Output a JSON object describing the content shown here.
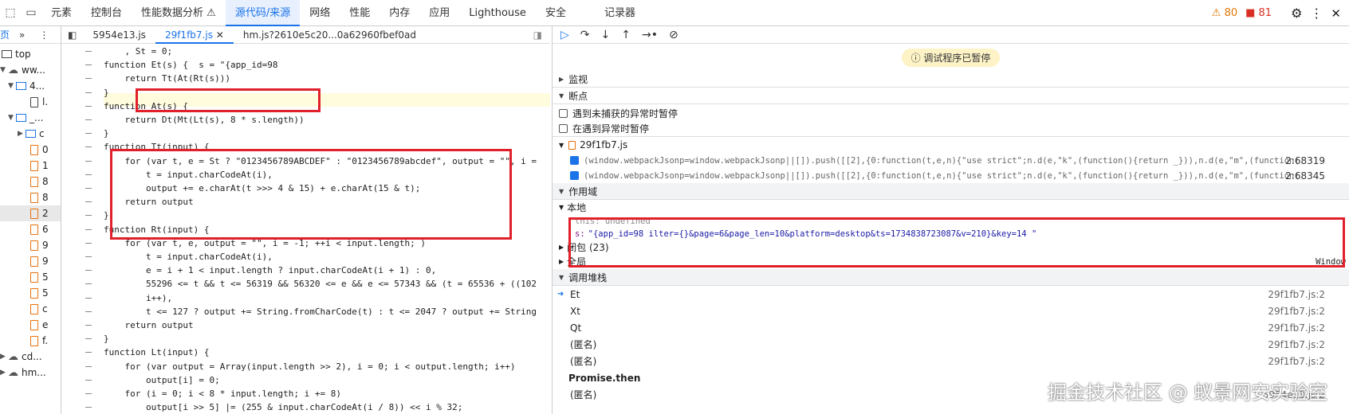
{
  "tabs": [
    "元素",
    "控制台",
    "性能数据分析 ⚠",
    "源代码/来源",
    "网络",
    "性能",
    "内存",
    "应用",
    "Lighthouse",
    "安全",
    "记录器"
  ],
  "warnings": "80",
  "errors": "81",
  "left_panel": {
    "header": "页",
    "items": [
      "top",
      "ww...",
      "4...",
      "l.",
      "_...",
      "c",
      "0",
      "1",
      "8",
      "8",
      "2",
      "6",
      "9",
      "9",
      "5",
      "5",
      "c",
      "e",
      "f.",
      "cd...",
      "hm..."
    ]
  },
  "source_tabs": [
    "5954e13.js",
    "29f1fb7.js",
    "hm.js?2610e5c20...0a62960fbef0ad"
  ],
  "code_lines": [
    "    , St = 0;",
    "function Et(s) {  s = \"{app_id=98",
    "    return Tt(At(Rt(s)))",
    "}",
    "function At(s) {",
    "    return Dt(Mt(Lt(s), 8 * s.length))",
    "}",
    "function Tt(input) {",
    "    for (var t, e = St ? \"0123456789ABCDEF\" : \"0123456789abcdef\", output = \"\", i =",
    "        t = input.charCodeAt(i),",
    "        output += e.charAt(t >>> 4 & 15) + e.charAt(15 & t);",
    "    return output",
    "}",
    "function Rt(input) {",
    "    for (var t, e, output = \"\", i = -1; ++i < input.length; )",
    "        t = input.charCodeAt(i),",
    "        e = i + 1 < input.length ? input.charCodeAt(i + 1) : 0,",
    "        55296 <= t && t <= 56319 && 56320 <= e && e <= 57343 && (t = 65536 + ((102",
    "        i++),",
    "        t <= 127 ? output += String.fromCharCode(t) : t <= 2047 ? output += String",
    "    return output",
    "}",
    "function Lt(input) {",
    "    for (var output = Array(input.length >> 2), i = 0; i < output.length; i++)",
    "        output[i] = 0;",
    "    for (i = 0; i < 8 * input.length; i += 8)",
    "        output[i >> 5] |= (255 & input.charCodeAt(i / 8)) << i % 32;"
  ],
  "paused_text": "调试程序已暂停",
  "sections": {
    "watch": "监视",
    "breakpoints": "断点",
    "scope": "作用域",
    "callstack": "调用堆栈"
  },
  "bp_options": [
    "遇到未捕获的异常时暂停",
    "在遇到异常时暂停"
  ],
  "bp_file": "29f1fb7.js",
  "breakpoints": [
    {
      "code": "(window.webpackJsonp=window.webpackJsonp||[]).push([[2],{0:function(t,e,n){\"use strict\";n.d(e,\"k\",(function(){return _})),n.d(e,\"m\",(function(){re",
      "loc": "2:68319"
    },
    {
      "code": "(window.webpackJsonp=window.webpackJsonp||[]).push([[2],{0:function(t,e,n){\"use strict\";n.d(e,\"k\",(function(){return _})),n.d(e,\"m\",(function(){re",
      "loc": "2:68345"
    }
  ],
  "scope": {
    "local_label": "本地",
    "this_line": "this: undefined",
    "s_label": "s:",
    "s_value": "\"{app_id=98          ilter={}&page=6&page_len=10&platform=desktop&ts=1734838723087&v=210}&key=14                         \"",
    "closure": "闭包 (23)",
    "global": "全局",
    "global_value": "Window"
  },
  "callstack": [
    {
      "name": "Et",
      "loc": "29f1fb7.js:2"
    },
    {
      "name": "Xt",
      "loc": "29f1fb7.js:2"
    },
    {
      "name": "Qt",
      "loc": "29f1fb7.js:2"
    },
    {
      "name": "(匿名)",
      "loc": "29f1fb7.js:2"
    },
    {
      "name": "(匿名)",
      "loc": "29f1fb7.js:2"
    },
    {
      "name": "Promise.then",
      "loc": ""
    },
    {
      "name": "(匿名)",
      "loc": "5954e13.js:2"
    }
  ],
  "watermark": "掘金技术社区 @ 蚁景网安实验室"
}
